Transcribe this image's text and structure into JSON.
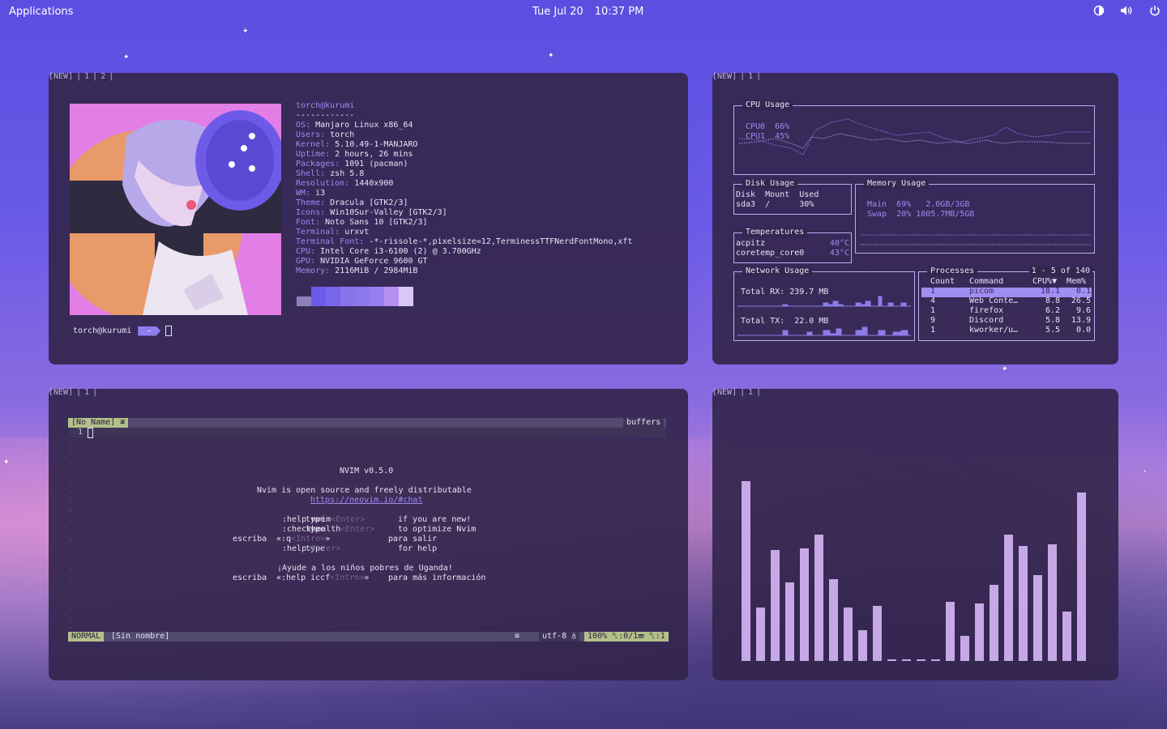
{
  "topbar": {
    "apps_label": "Applications",
    "date": "Tue Jul 20",
    "time": "10:37 PM",
    "icons": [
      "brightness-icon",
      "volume-icon",
      "power-icon"
    ]
  },
  "workspace_tags": {
    "neofetch": [
      "[NEW]",
      "|",
      "1",
      "|",
      "2",
      "|"
    ],
    "gotop": [
      "[NEW]",
      "|",
      "1",
      "|"
    ],
    "nvim": [
      "[NEW]",
      "|",
      "1",
      "|"
    ],
    "cava": [
      "[NEW]",
      "|",
      "1",
      "|"
    ]
  },
  "neofetch": {
    "user_host": "torch@kurumi",
    "separator": "------------",
    "fields": [
      {
        "k": "OS",
        "v": "Manjaro Linux x86_64"
      },
      {
        "k": "Users",
        "v": "torch"
      },
      {
        "k": "Kernel",
        "v": "5.10.49-1-MANJARO"
      },
      {
        "k": "Uptime",
        "v": "2 hours, 26 mins"
      },
      {
        "k": "Packages",
        "v": "1091 (pacman)"
      },
      {
        "k": "Shell",
        "v": "zsh 5.8"
      },
      {
        "k": "Resolution",
        "v": "1440x900"
      },
      {
        "k": "WM",
        "v": "i3"
      },
      {
        "k": "Theme",
        "v": "Dracula [GTK2/3]"
      },
      {
        "k": "Icons",
        "v": "Win10Sur-Valley [GTK2/3]"
      },
      {
        "k": "Font",
        "v": "Noto Sans 10 [GTK2/3]"
      },
      {
        "k": "Terminal",
        "v": "urxvt"
      },
      {
        "k": "Terminal Font",
        "v": "-*-rissole-*,pixelsize=12,TerminessTTFNerdFontMono,xft"
      },
      {
        "k": "CPU",
        "v": "Intel Core i3-6100 (2) @ 3.700GHz"
      },
      {
        "k": "GPU",
        "v": "NVIDIA GeForce 9600 GT"
      },
      {
        "k": "Memory",
        "v": "2116MiB / 2984MiB"
      }
    ],
    "swatch_colors": [
      "#8c82b8",
      "#6c5ae8",
      "#7a66ea",
      "#8a74ec",
      "#8e78ee",
      "#9680ee",
      "#b68ef0",
      "#d8c8f6"
    ],
    "prompt_user": "torch@kurumi",
    "prompt_dir": "~"
  },
  "gotop": {
    "cpu": {
      "title": "CPU Usage",
      "lines": [
        "CPU0  66%",
        "CPU1  45%"
      ]
    },
    "disk": {
      "title": "Disk Usage",
      "header": "Disk  Mount  Used",
      "row": "sda3  /      30%"
    },
    "memory": {
      "title": "Memory Usage",
      "main": "Main  69%   2.0GB/3GB",
      "swap": "Swap  20% 1005.7MB/5GB"
    },
    "temps": {
      "title": "Temperatures",
      "rows": [
        {
          "name": "acpitz",
          "val": "40°C"
        },
        {
          "name": "coretemp_core0",
          "val": "43°C"
        }
      ]
    },
    "network": {
      "title": "Network Usage",
      "rx": "Total RX: 239.7 MB",
      "tx": "Total TX:  22.0 MB"
    },
    "processes": {
      "title": "Processes",
      "range": "1 - 5 of 140",
      "headers": [
        "Count",
        "Command",
        "CPU%▼",
        "Mem%"
      ],
      "rows": [
        [
          "1",
          "picom",
          "18.1",
          "0.1"
        ],
        [
          "4",
          "Web Conte…",
          "8.8",
          "26.5"
        ],
        [
          "1",
          "firefox",
          "6.2",
          "9.6"
        ],
        [
          "9",
          "Discord",
          "5.8",
          "13.9"
        ],
        [
          "1",
          "kworker/u…",
          "5.5",
          "0.0"
        ]
      ]
    }
  },
  "nvim": {
    "tab_label": "[No Name]",
    "tab_icon": "≢",
    "buffers_label": "buffers",
    "line_number": "1",
    "title": "NVIM v0.5.0",
    "tagline": "Nvim is open source and freely distributable",
    "url": "https://neovim.io/#chat",
    "help_rows": [
      {
        "pre": "type",
        "cmd": ":help nvim",
        "key": "<Enter>",
        "desc": "if you are new!"
      },
      {
        "pre": "type",
        "cmd": ":checkhealth",
        "key": "<Enter>",
        "desc": "to optimize Nvim"
      },
      {
        "pre": "escriba",
        "cmd": "«:q",
        "key": "<Intro>",
        "post": "»",
        "desc": "para salir"
      },
      {
        "pre": "type",
        "cmd": ":help",
        "key": "<Enter>",
        "desc": "for help"
      }
    ],
    "uganda": "¡Ayude a los niños pobres de Uganda!",
    "iccf_pre": "escriba",
    "iccf_cmd": "«:help iccf",
    "iccf_key": "<Intro>",
    "iccf_post": "»",
    "iccf_desc": "para más información",
    "mode": "NORMAL",
    "filename": "[Sin nombre]",
    "ft_icon": "≡",
    "encoding": "utf-8 ♁",
    "percent": "100%",
    "position": "␤:0/1☰",
    "column": "␤:1"
  },
  "cava": {
    "bar_levels": [
      0.94,
      0.28,
      0.58,
      0.41,
      0.59,
      0.66,
      0.43,
      0.28,
      0.16,
      0.29,
      0.01,
      0.01,
      0.01,
      0.01,
      0.31,
      0.13,
      0.3,
      0.4,
      0.66,
      0.6,
      0.45,
      0.61,
      0.26,
      0.88
    ],
    "bar_color": "#c7a8e6"
  }
}
